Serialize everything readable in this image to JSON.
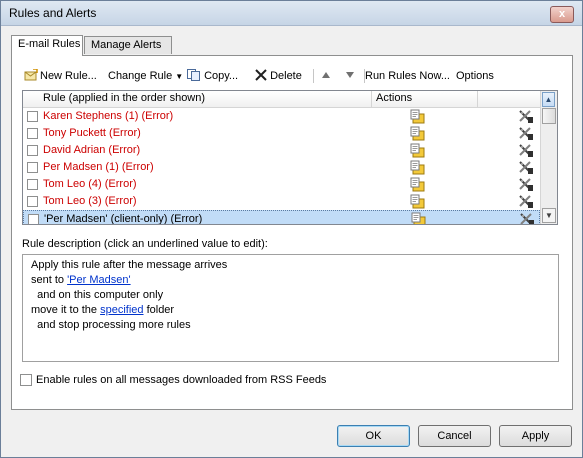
{
  "window": {
    "title": "Rules and Alerts",
    "close_glyph": "x"
  },
  "tabs": [
    {
      "label": "E-mail Rules",
      "active": true
    },
    {
      "label": "Manage Alerts",
      "active": false
    }
  ],
  "toolbar": {
    "new_rule": "New Rule...",
    "change_rule": "Change Rule",
    "copy": "Copy...",
    "delete": "Delete",
    "run_rules": "Run Rules Now...",
    "options": "Options"
  },
  "list": {
    "col_rule": "Rule (applied in the order shown)",
    "col_actions": "Actions",
    "rows": [
      {
        "label": "Karen Stephens (1)  (Error)",
        "checked": false,
        "selected": false
      },
      {
        "label": "Tony Puckett  (Error)",
        "checked": false,
        "selected": false
      },
      {
        "label": "David Adrian  (Error)",
        "checked": false,
        "selected": false
      },
      {
        "label": "Per Madsen (1)  (Error)",
        "checked": false,
        "selected": false
      },
      {
        "label": "Tom Leo (4)  (Error)",
        "checked": false,
        "selected": false
      },
      {
        "label": "Tom Leo (3)  (Error)",
        "checked": false,
        "selected": false
      },
      {
        "label": "'Per Madsen'  (client-only)  (Error)",
        "checked": false,
        "selected": true
      }
    ]
  },
  "description": {
    "label": "Rule description (click an underlined value to edit):",
    "line1": "Apply this rule after the message arrives",
    "line2_prefix": "sent to ",
    "line2_link": "'Per Madsen'",
    "line3": "  and on this computer only",
    "line4_prefix": "move it to the ",
    "line4_link": "specified",
    "line4_suffix": " folder",
    "line5": "  and stop processing more rules"
  },
  "rss": {
    "label": "Enable rules on all messages downloaded from RSS Feeds",
    "checked": false
  },
  "buttons": {
    "ok": "OK",
    "cancel": "Cancel",
    "apply": "Apply"
  },
  "colors": {
    "error_text": "#cc0000",
    "link": "#0033cc",
    "selection": "#c1dcf7"
  }
}
